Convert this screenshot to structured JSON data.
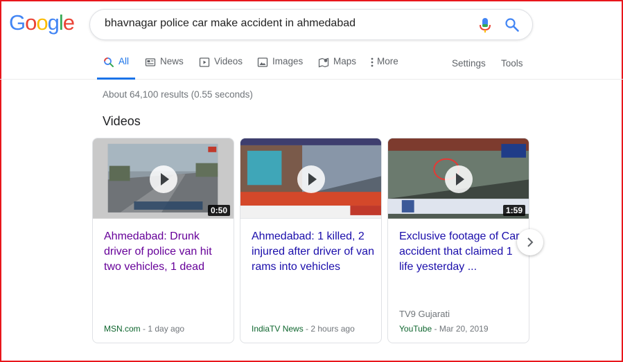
{
  "logo": {
    "letters": [
      "G",
      "o",
      "o",
      "g",
      "l",
      "e"
    ],
    "colors": [
      "#4285f4",
      "#ea4335",
      "#fbbc05",
      "#4285f4",
      "#34a853",
      "#ea4335"
    ]
  },
  "search": {
    "query": "bhavnagar police car make accident in ahmedabad"
  },
  "tabs": [
    {
      "label": "All",
      "icon": "search-icon",
      "active": true
    },
    {
      "label": "News",
      "icon": "news-icon"
    },
    {
      "label": "Videos",
      "icon": "video-icon"
    },
    {
      "label": "Images",
      "icon": "image-icon"
    },
    {
      "label": "Maps",
      "icon": "map-icon"
    },
    {
      "label": "More",
      "icon": "more-vert-icon"
    }
  ],
  "tools": {
    "settings": "Settings",
    "tools": "Tools"
  },
  "stats": "About 64,100 results (0.55 seconds)",
  "videos_heading": "Videos",
  "cards": [
    {
      "title": "Ahmedabad: Drunk driver of police van hit two vehicles, 1 dead",
      "duration": "0:50",
      "site": "MSN.com",
      "date": " - 1 day ago",
      "channel": ""
    },
    {
      "title": "Ahmedabad: 1 killed, 2 injured after driver of van rams into vehicles",
      "duration": "",
      "site": "IndiaTV News",
      "date": " - 2 hours ago",
      "channel": ""
    },
    {
      "title": "Exclusive footage of Car accident that claimed 1 life yesterday ...",
      "duration": "1:59",
      "site": "YouTube",
      "date": " - Mar 20, 2019",
      "channel": "TV9 Gujarati"
    }
  ],
  "colors": {
    "accent": "#1a73e8",
    "visited": "#660099",
    "link": "#1a0dab",
    "source": "#0d652d",
    "frame": "#e8161c"
  }
}
